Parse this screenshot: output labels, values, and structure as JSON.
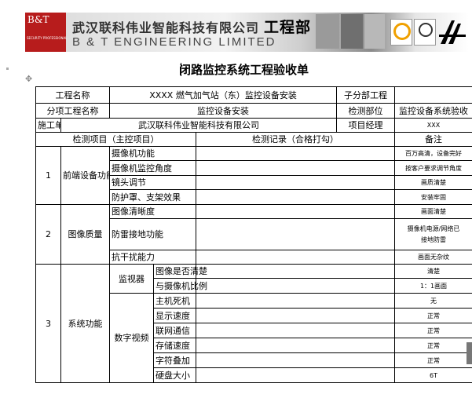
{
  "banner": {
    "logo_bt": "B&T",
    "logo_sub": "SECURITY PROFESSIONAL",
    "company_cn": "武汉联科伟业智能科技有限公司",
    "company_suffix": "工程部",
    "company_en": "B & T ENGINEERING LIMITED",
    "badge_icons": [
      "sgs-cert-icon",
      "cert-seal-icon",
      "sa-logo-icon"
    ]
  },
  "title": "闭路监控系统工程验收单",
  "info": {
    "project_name_label": "工程名称",
    "project_name": "XXXX 燃气加气站（东）监控设备安装",
    "sub_project_label": "子分部工程",
    "sub_project": "",
    "item_label": "分项工程名称",
    "item": "监控设备安装",
    "dept_label": "检测部位",
    "dept": "监控设备系统验收",
    "contractor_label": "施工单位",
    "contractor": "武汉联科伟业智能科技有限公司",
    "manager_label": "项目经理",
    "manager": "XXX"
  },
  "headers": {
    "items": "检测项目（主控项目）",
    "record": "检测记录（合格打勾）",
    "remark": "备注"
  },
  "groups": [
    {
      "no": "1",
      "name": "前端设备功能",
      "rows": [
        {
          "item": "摄像机功能",
          "remark": "百万高清，设备完好"
        },
        {
          "item": "摄像机监控角度",
          "remark": "按客户要求调节角度"
        },
        {
          "item": "镜头调节",
          "remark": "画质清楚"
        },
        {
          "item": "防护罩、支架效果",
          "remark": "安装牢固"
        }
      ]
    },
    {
      "no": "2",
      "name": "图像质量",
      "rows": [
        {
          "item": "图像清晰度",
          "remark": "画面清楚"
        },
        {
          "item": "防雷接地功能",
          "remark_line1": "摄像机电源/网络已",
          "remark_line2": "接地防雷"
        },
        {
          "item": "抗干扰能力",
          "remark": "画面无杂纹"
        }
      ]
    },
    {
      "no": "3",
      "name": "系统功能",
      "subgroups": [
        {
          "name": "监视器",
          "rows": [
            {
              "item": "图像是否清楚",
              "remark": "清楚"
            },
            {
              "item": "与摄像机比例",
              "remark": "1：1画面"
            }
          ]
        },
        {
          "name": "数字视频",
          "rows": [
            {
              "item": "主机死机",
              "remark": "无"
            },
            {
              "item": "显示速度",
              "remark": "正常"
            },
            {
              "item": "联网通信",
              "remark": "正常"
            },
            {
              "item": "存储速度",
              "remark": "正常"
            },
            {
              "item": "字符叠加",
              "remark": "正常"
            },
            {
              "item": "硬盘大小",
              "remark": "6T"
            }
          ]
        }
      ]
    }
  ]
}
